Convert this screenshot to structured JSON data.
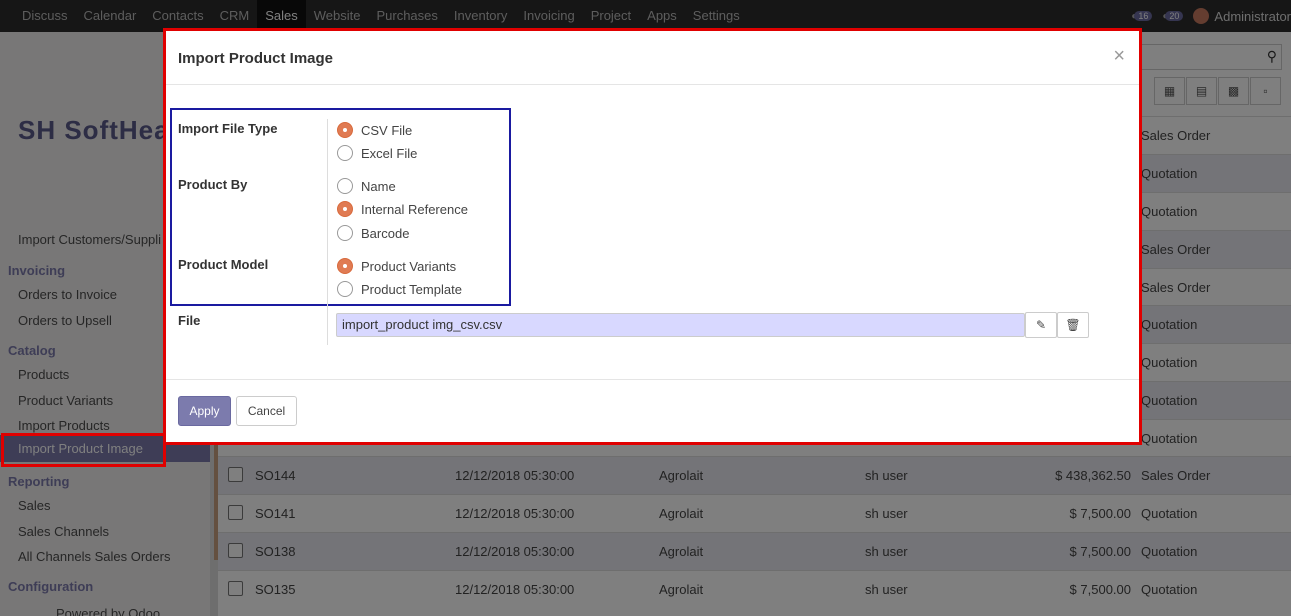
{
  "navbar": {
    "menu": [
      "Discuss",
      "Calendar",
      "Contacts",
      "CRM",
      "Sales",
      "Website",
      "Purchases",
      "Inventory",
      "Invoicing",
      "Project",
      "Apps",
      "Settings"
    ],
    "active": "Sales",
    "messages_count": "16",
    "activities_count": "20",
    "user": "Administrator"
  },
  "sidebar": {
    "logo": "SH SoftHea",
    "cut_item": "Import Customers/Suppli",
    "sections": [
      {
        "title": "Invoicing",
        "items": [
          "Orders to Invoice",
          "Orders to Upsell"
        ]
      },
      {
        "title": "Catalog",
        "items": [
          "Products",
          "Product Variants",
          "Import Products",
          "Import Product Image"
        ]
      },
      {
        "title": "Reporting",
        "items": [
          "Sales",
          "Sales Channels",
          "All Channels Sales Orders"
        ]
      },
      {
        "title": "Configuration",
        "items": []
      }
    ],
    "footer": "Powered by Odoo"
  },
  "background_status": [
    "Sales Order",
    "Quotation",
    "Quotation",
    "Sales Order",
    "Sales Order",
    "Quotation",
    "Quotation",
    "Quotation",
    "Quotation"
  ],
  "orders": [
    {
      "number": "SO144",
      "date": "12/12/2018 05:30:00",
      "customer": "Agrolait",
      "salesperson": "sh user",
      "total": "$ 438,362.50",
      "status": "Sales Order"
    },
    {
      "number": "SO141",
      "date": "12/12/2018 05:30:00",
      "customer": "Agrolait",
      "salesperson": "sh user",
      "total": "$ 7,500.00",
      "status": "Quotation"
    },
    {
      "number": "SO138",
      "date": "12/12/2018 05:30:00",
      "customer": "Agrolait",
      "salesperson": "sh user",
      "total": "$ 7,500.00",
      "status": "Quotation"
    },
    {
      "number": "SO135",
      "date": "12/12/2018 05:30:00",
      "customer": "Agrolait",
      "salesperson": "sh user",
      "total": "$ 7,500.00",
      "status": "Quotation"
    }
  ],
  "modal": {
    "title": "Import Product Image",
    "close": "×",
    "import_file_type": {
      "label": "Import File Type",
      "options": [
        "CSV File",
        "Excel File"
      ],
      "selected": "CSV File"
    },
    "product_by": {
      "label": "Product By",
      "options": [
        "Name",
        "Internal Reference",
        "Barcode"
      ],
      "selected": "Internal Reference"
    },
    "product_model": {
      "label": "Product Model",
      "options": [
        "Product Variants",
        "Product Template"
      ],
      "selected": "Product Variants"
    },
    "file": {
      "label": "File",
      "value": "import_product img_csv.csv"
    },
    "apply": "Apply",
    "cancel": "Cancel"
  },
  "colors": {
    "accent": "#7c7bad",
    "highlight": "#e00000",
    "box": "#1a1aa0",
    "radio_on": "#e07b53"
  }
}
